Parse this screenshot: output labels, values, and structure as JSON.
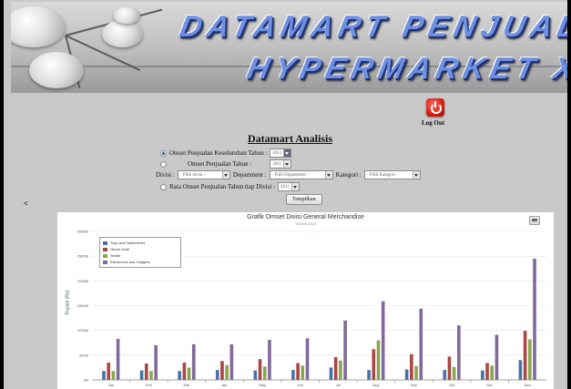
{
  "header": {
    "title_line1": "DATAMART PENJUALAN",
    "title_line2": "HYPERMARKET XYZ"
  },
  "logout": {
    "label": "Log Out"
  },
  "page": {
    "heading": "Datamart Analisis",
    "back_arrow": "<"
  },
  "form": {
    "option1": {
      "label": "Omset Penjualan Keseluruhan Tahun :",
      "selected": true,
      "year": "2011"
    },
    "option2": {
      "label": "Omset Penjualan Tahun :",
      "selected": false,
      "year": "2011"
    },
    "divisi": {
      "label": "Divisi :",
      "value": "- Pilih divisi -"
    },
    "department": {
      "label": "Department :",
      "value": "- Pilih Department -"
    },
    "kategori": {
      "label": "Kategori :",
      "value": "- Pilih Kategori -"
    },
    "option3": {
      "label": "Rata Omset Penjualan Tahun tiap Divisi :",
      "selected": false,
      "year": "2011"
    },
    "submit_label": "Tampilkan"
  },
  "colors": {
    "toys": "#4572a7",
    "house_hold": "#aa4643",
    "textile": "#89a54e",
    "electronics": "#80699b"
  },
  "chart_data": {
    "type": "bar",
    "title": "Grafik Omset Divisi General Merchandise",
    "subtitle": "TAHUN 2011",
    "ylabel": "Rupiah (Rp)",
    "ylim": [
      0,
      3000
    ],
    "yticks": [
      "0M",
      "500M",
      "1000M",
      "1500M",
      "2000M",
      "2500M",
      "3000M"
    ],
    "legend_position": "top-left",
    "categories": [
      "Jan",
      "Feb",
      "Mar",
      "Apr",
      "May",
      "Jun",
      "Jul",
      "Aug",
      "Sep",
      "Oct",
      "Nov",
      "Dec"
    ],
    "series": [
      {
        "name": "Toys and Stationeries",
        "color": "#4572a7",
        "values": [
          180,
          190,
          180,
          200,
          190,
          200,
          250,
          200,
          210,
          200,
          190,
          400
        ]
      },
      {
        "name": "House Hold",
        "color": "#aa4643",
        "values": [
          350,
          330,
          350,
          380,
          420,
          340,
          460,
          620,
          520,
          470,
          340,
          990
        ]
      },
      {
        "name": "Textile",
        "color": "#89a54e",
        "values": [
          180,
          180,
          250,
          300,
          270,
          290,
          390,
          800,
          280,
          260,
          290,
          820
        ]
      },
      {
        "name": "Electronics and Gadgets",
        "color": "#80699b",
        "values": [
          830,
          700,
          720,
          720,
          810,
          840,
          1200,
          1590,
          1440,
          1100,
          910,
          2450
        ]
      }
    ]
  }
}
